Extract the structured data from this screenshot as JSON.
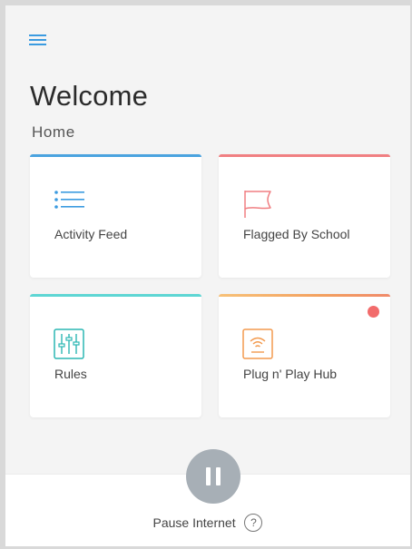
{
  "header": {
    "menu_icon": "hamburger-menu-icon",
    "title": "Welcome",
    "subtitle": "Home"
  },
  "cards": [
    {
      "label": "Activity Feed",
      "icon": "list-icon",
      "accent": "#4aa3df"
    },
    {
      "label": "Flagged By School",
      "icon": "flag-icon",
      "accent": "#f07f82"
    },
    {
      "label": "Rules",
      "icon": "sliders-icon",
      "accent": "#5ed6d4"
    },
    {
      "label": "Plug n' Play Hub",
      "icon": "wifi-hub-icon",
      "accent": "#f5a96a",
      "notification": true
    }
  ],
  "footer": {
    "pause_label": "Pause Internet",
    "pause_icon": "pause-icon",
    "help_icon": "question-mark-icon",
    "help_glyph": "?"
  },
  "colors": {
    "menu": "#3b9be0",
    "pause_button": "#a7afb6",
    "notification_dot": "#f26b6b",
    "list_icon": "#3b9be0",
    "flag_icon": "#f07f82",
    "sliders_icon": "#2bb7b3",
    "hub_icon": "#f39a4e"
  }
}
